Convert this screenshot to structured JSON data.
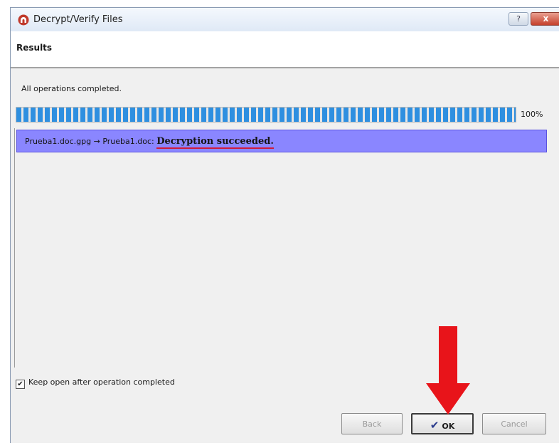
{
  "window": {
    "title": "Decrypt/Verify Files",
    "help_label": "?",
    "close_label": "x"
  },
  "page": {
    "title": "Results"
  },
  "status": {
    "text": "All operations completed.",
    "progress_percent": 100,
    "progress_label": "100%"
  },
  "results": {
    "rows": [
      {
        "file": "Prueba1.doc.gpg → Prueba1.doc:",
        "message": "Decryption succeeded."
      }
    ]
  },
  "options": {
    "keep_open_label": "Keep open after operation completed",
    "keep_open_checked": true
  },
  "buttons": {
    "back_label": "Back",
    "ok_label": "OK",
    "cancel_label": "Cancel"
  },
  "colors": {
    "progress": "#2e8fe0",
    "result_row": "#8a86ff",
    "arrow": "#e8141a"
  },
  "icons": {
    "app": "kleopatra-icon",
    "ok": "checkmark-icon",
    "annotation": "red-down-arrow"
  }
}
